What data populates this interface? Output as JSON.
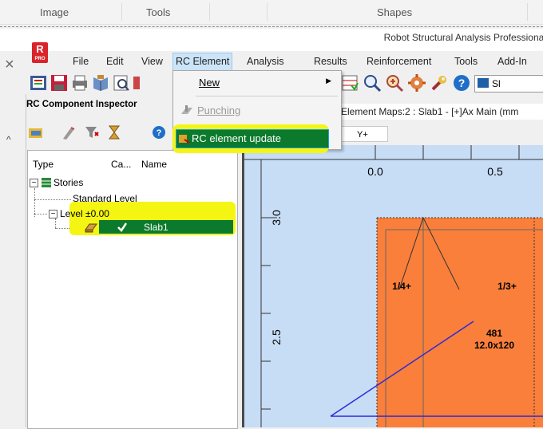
{
  "ribbon": {
    "tabs": [
      "Image",
      "Tools",
      "Shapes"
    ]
  },
  "app": {
    "title": "Robot Structural Analysis Professional",
    "logo_letter": "R",
    "logo_sub": "PRO"
  },
  "menu": {
    "items": [
      "File",
      "Edit",
      "View",
      "RC Element",
      "Analysis",
      "Results",
      "Reinforcement",
      "Tools",
      "Add-In"
    ],
    "active": "RC Element"
  },
  "dropdown": {
    "items": [
      {
        "label": "New",
        "has_submenu": true,
        "enabled": true
      },
      {
        "label": "Punching",
        "has_submenu": false,
        "enabled": false
      },
      {
        "label": "RC element update",
        "has_submenu": false,
        "enabled": true,
        "highlighted": true
      }
    ]
  },
  "toolbar": {
    "combo_text": "Sl"
  },
  "inspector": {
    "title": "RC Component Inspector",
    "columns": [
      "Type",
      "Ca...",
      "Name"
    ],
    "tree": {
      "root": "Stories",
      "children": [
        "Standard Level",
        "Level ±0.00"
      ],
      "selected": "Slab1"
    }
  },
  "map": {
    "title": "Element Maps:2 : Slab1 - [+]Ax Main (mm",
    "tab": "Y+",
    "axis_top": [
      "0.0",
      "0.5"
    ],
    "axis_left": [
      "3.0",
      "2.5"
    ],
    "labels": {
      "left": "1/4+",
      "right": "1/3+",
      "bar_count": "481",
      "bar_size": "12.0x120"
    }
  },
  "colors": {
    "highlight": "#f5f514",
    "select": "#0b7a2c",
    "slab": "#f97f3b",
    "canvas": "#c7dcf5",
    "line": "#2b2bd8",
    "accent": "#d8242a"
  }
}
